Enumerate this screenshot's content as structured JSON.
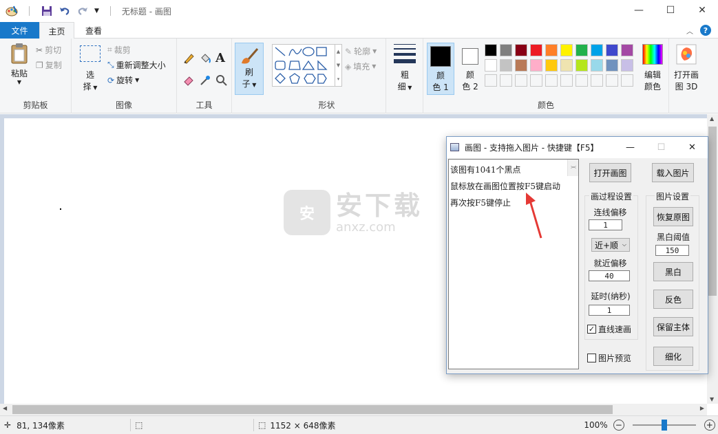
{
  "app": {
    "title": "无标题 - 画图",
    "controls": {
      "minimize": "—",
      "maximize": "☐",
      "close": "✕"
    }
  },
  "tabs": [
    {
      "label": "文件"
    },
    {
      "label": "主页"
    },
    {
      "label": "查看"
    }
  ],
  "ribbon": {
    "clipboard": {
      "paste": "粘贴",
      "cut": "剪切",
      "copy": "复制",
      "label": "剪贴板"
    },
    "image": {
      "select_1": "选",
      "select_2": "择",
      "crop": "裁剪",
      "resize": "重新调整大小",
      "rotate": "旋转",
      "label": "图像"
    },
    "tools": {
      "label": "工具",
      "text_glyph": "A"
    },
    "brushes": {
      "label_1": "刷",
      "label_2": "子"
    },
    "shapes": {
      "outline": "轮廓",
      "fill": "填充",
      "label": "形状"
    },
    "size": {
      "label_1": "粗",
      "label_2": "细"
    },
    "color1": {
      "l1": "颜",
      "l2": "色 1",
      "value": "#000000"
    },
    "color2": {
      "l1": "颜",
      "l2": "色 2",
      "value": "#ffffff"
    },
    "palette": [
      "#000000",
      "#7f7f7f",
      "#880015",
      "#ed1c24",
      "#ff7f27",
      "#fff200",
      "#22b14c",
      "#00a2e8",
      "#3f48cc",
      "#a349a4",
      "#ffffff",
      "#c3c3c3",
      "#b97a57",
      "#ffaec9",
      "#ffc90e",
      "#efe4b0",
      "#b5e61d",
      "#99d9ea",
      "#7092be",
      "#c8bfe7"
    ],
    "edit_colors": {
      "l1": "编辑",
      "l2": "颜色"
    },
    "paint3d": {
      "l1": "打开画",
      "l2": "图 3D"
    },
    "colors_label": "颜色"
  },
  "status": {
    "cursor_pos": "81, 134像素",
    "image_size": "1152 × 648像素",
    "zoom": "100%",
    "zoom_fraction": 0.5
  },
  "dialog": {
    "title": "画图 - 支持拖入图片 - 快捷键【F5】",
    "log": [
      "该图有1041个黑点",
      "鼠标放在画图位置按F5键启动",
      "再次按F5键停止"
    ],
    "open_paint": "打开画图",
    "load_image": "载入图片",
    "draw_settings": "画过程设置",
    "image_settings": "图片设置",
    "line_offset_label": "连线偏移",
    "line_offset_value": "1",
    "order_select": "近+顺",
    "near_offset_label": "就近偏移",
    "near_offset_value": "40",
    "delay_label": "延时(纳秒)",
    "delay_value": "1",
    "straight_fast": "直线速画",
    "straight_fast_checked": "✓",
    "preview": "图片预览",
    "restore": "恢复原图",
    "bw_threshold_label": "黑白阈值",
    "bw_threshold_value": "150",
    "bw": "黑白",
    "invert": "反色",
    "keep_subject": "保留主体",
    "thin": "细化"
  },
  "watermark": {
    "text_cn": "安下载",
    "text_en": "anxz.com",
    "shield": "安"
  }
}
